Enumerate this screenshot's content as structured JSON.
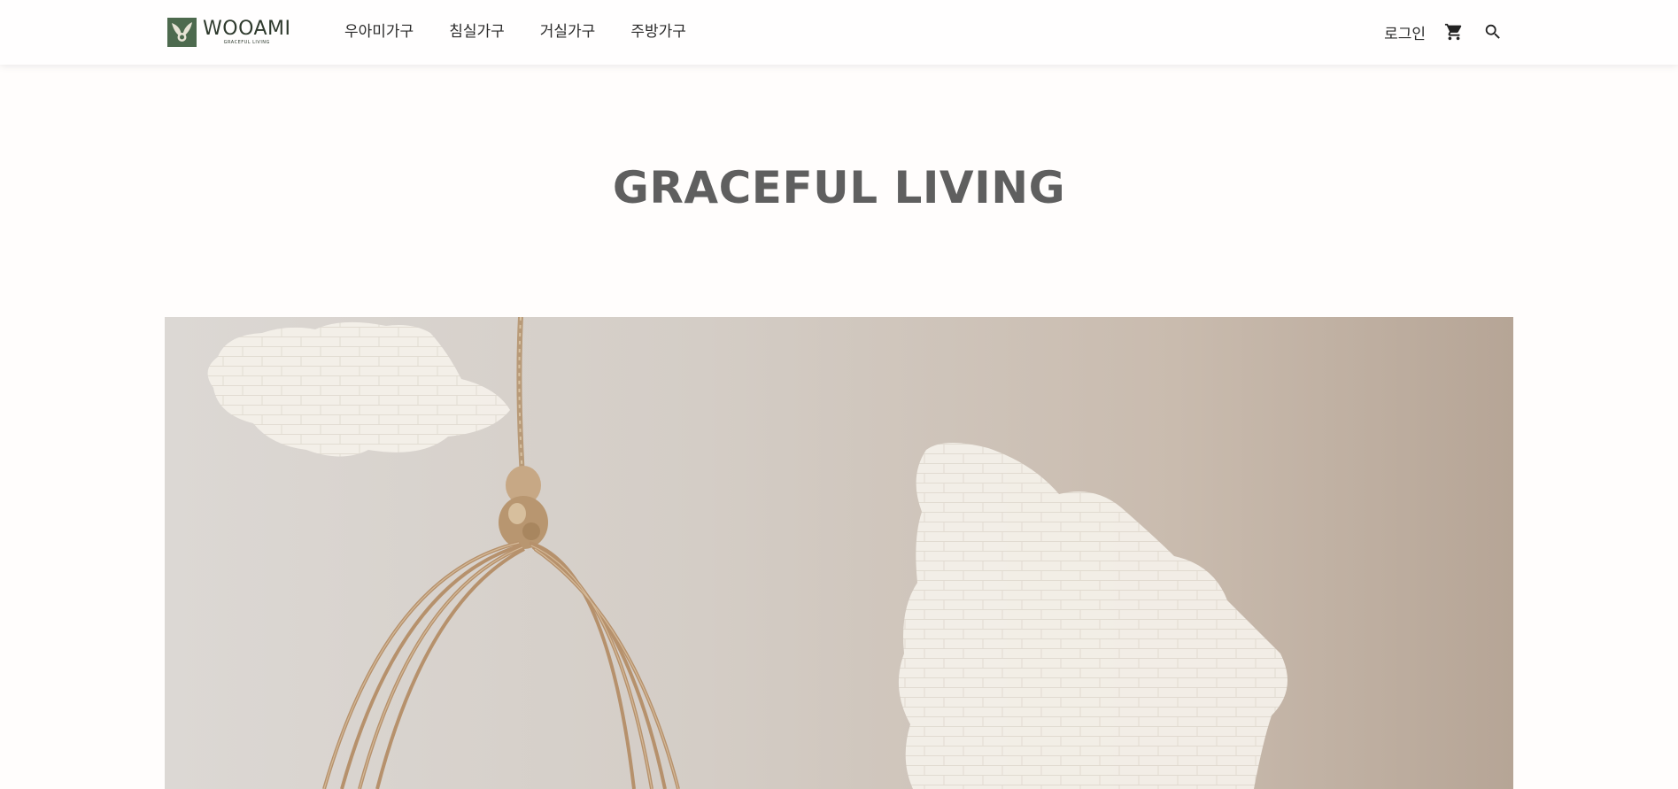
{
  "header": {
    "logo": {
      "wordmark": "WOOAMI",
      "tagline": "GRACEFUL LIVING"
    },
    "nav": [
      {
        "label": "우아미가구"
      },
      {
        "label": "침실가구"
      },
      {
        "label": "거실가구"
      },
      {
        "label": "주방가구"
      }
    ],
    "utility": {
      "login_label": "로그인",
      "cart_icon": "cart-icon",
      "search_icon": "search-icon"
    }
  },
  "hero": {
    "title": "GRACEFUL LIVING"
  },
  "colors": {
    "brand_green": "#4d6a4e",
    "title_gray": "#5f5f5f"
  }
}
